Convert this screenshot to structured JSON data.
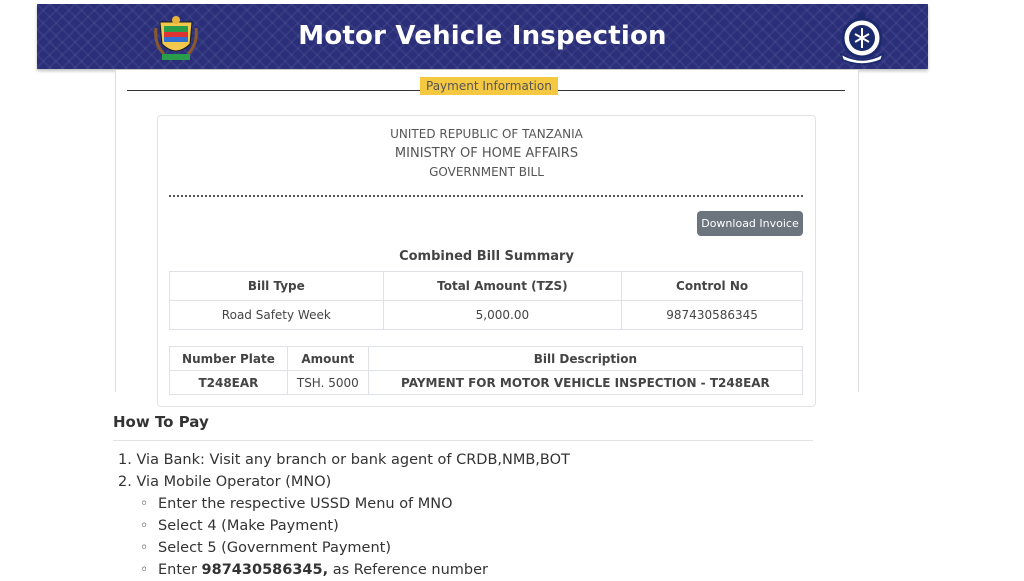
{
  "header": {
    "title": "Motor Vehicle Inspection",
    "brand_color": "#2b2f7a"
  },
  "legend": "Payment Information",
  "bill": {
    "country": "UNITED REPUBLIC OF TANZANIA",
    "ministry": "MINISTRY OF HOME AFFAIRS",
    "bill_type": "GOVERNMENT BILL",
    "download_label": "Download Invoice",
    "summary_title": "Combined Bill Summary",
    "summary_headers": [
      "Bill Type",
      "Total Amount (TZS)",
      "Control No"
    ],
    "summary_row": [
      "Road Safety Week",
      "5,000.00",
      "987430586345"
    ],
    "detail_headers": [
      "Number Plate",
      "Amount",
      "Bill Description"
    ],
    "detail_row": [
      "T248EAR",
      "TSH. 5000",
      "PAYMENT FOR MOTOR VEHICLE INSPECTION - T248EAR"
    ]
  },
  "how_to_pay": {
    "title": "How To Pay",
    "steps": [
      "1. Via Bank: Visit any branch or bank agent of CRDB,NMB,BOT",
      "2. Via Mobile Operator (MNO)"
    ],
    "mno_steps": [
      "Enter the respective USSD Menu of MNO",
      "Select 4 (Make Payment)",
      "Select 5 (Government Payment)"
    ],
    "enter_prefix": "Enter ",
    "enter_number": "987430586345,",
    "enter_suffix": " as Reference number"
  },
  "icons": [
    "tanzania-coat-of-arms-logo",
    "tanzania-police-logo"
  ]
}
